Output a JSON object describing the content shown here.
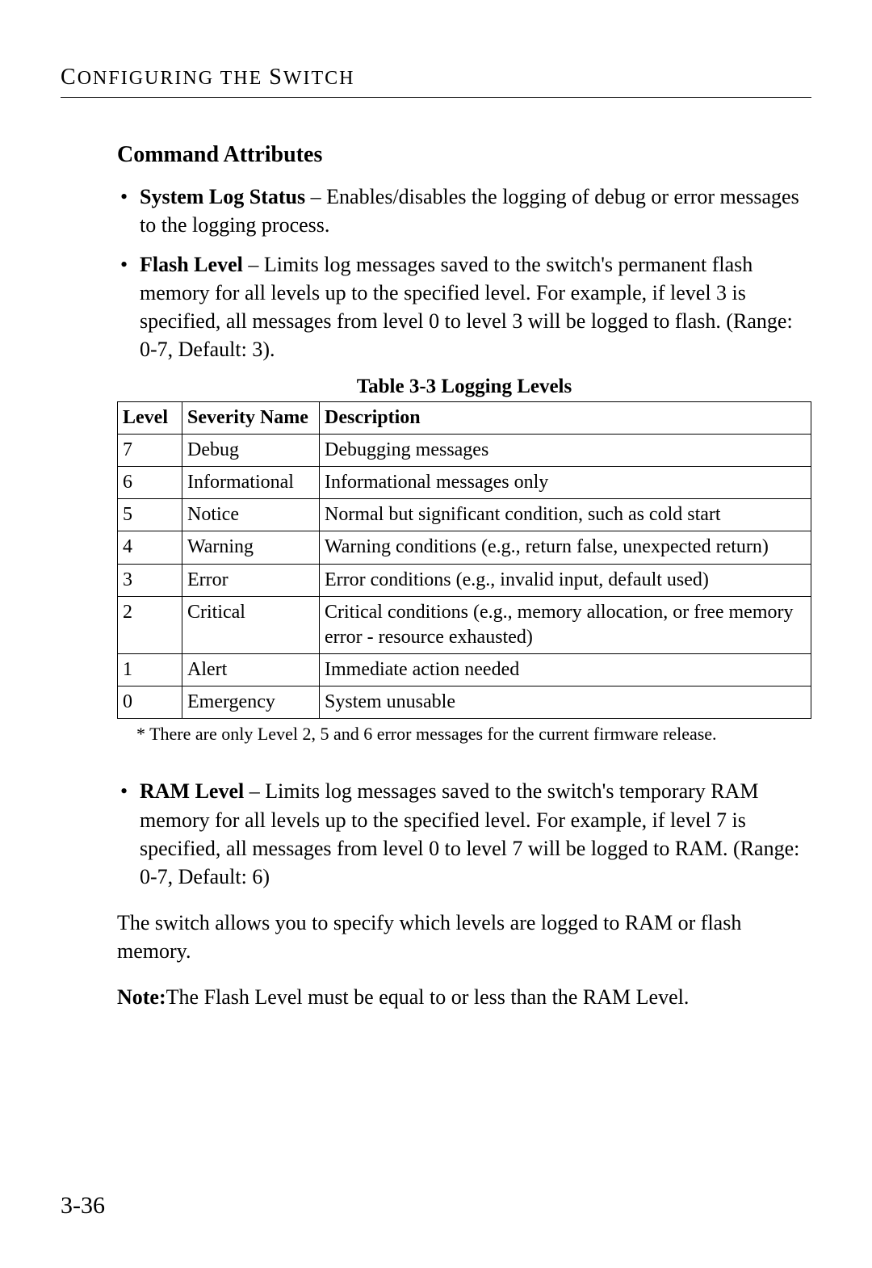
{
  "runningHead": {
    "pre": "C",
    "word1_rest": "ONFIGURING",
    "mid": " THE ",
    "cap2": "S",
    "word2_rest": "WITCH"
  },
  "sectionHeading": "Command Attributes",
  "bullets": {
    "b1": {
      "term": "System Log Status",
      "sep": " – ",
      "text": "Enables/disables the logging of debug or error messages to the logging process."
    },
    "b2": {
      "term": "Flash Level",
      "sep": " – ",
      "text": "Limits log messages saved to the switch's permanent flash memory for all levels up to the specified level. For example, if level 3 is specified, all messages from level 0 to level 3 will be logged to flash. (Range: 0-7, Default: 3)."
    },
    "b3": {
      "term": "RAM Level",
      "sep": " – ",
      "text": "Limits log messages saved to the switch's temporary RAM memory for all levels up to the specified level. For example, if level 7 is specified, all messages from level 0 to level 7 will be logged to RAM. (Range: 0-7, Default: 6)"
    }
  },
  "tableCaption": "Table 3-3  Logging Levels",
  "tableHeaders": {
    "h1": "Level",
    "h2": "Severity Name",
    "h3": "Description"
  },
  "rows": [
    {
      "level": "7",
      "name": "Debug",
      "desc": "Debugging messages"
    },
    {
      "level": "6",
      "name": "Informational",
      "desc": "Informational messages only"
    },
    {
      "level": "5",
      "name": "Notice",
      "desc": "Normal but significant condition, such as cold start"
    },
    {
      "level": "4",
      "name": "Warning",
      "desc": "Warning conditions (e.g., return false, unexpected return)"
    },
    {
      "level": "3",
      "name": "Error",
      "desc": "Error conditions (e.g., invalid input, default used)"
    },
    {
      "level": "2",
      "name": "Critical",
      "desc": "Critical conditions (e.g., memory allocation, or free memory error - resource exhausted)"
    },
    {
      "level": "1",
      "name": "Alert",
      "desc": "Immediate action needed"
    },
    {
      "level": "0",
      "name": "Emergency",
      "desc": "System unusable"
    }
  ],
  "tableFootnote": "*  There are only Level 2, 5 and 6 error messages for the current firmware release.",
  "para1": "The switch allows you to specify which levels are logged to RAM or flash memory.",
  "note": {
    "label": "Note:",
    "text": "The Flash Level must be equal to or less than the RAM Level."
  },
  "pageNumber": "3-36"
}
